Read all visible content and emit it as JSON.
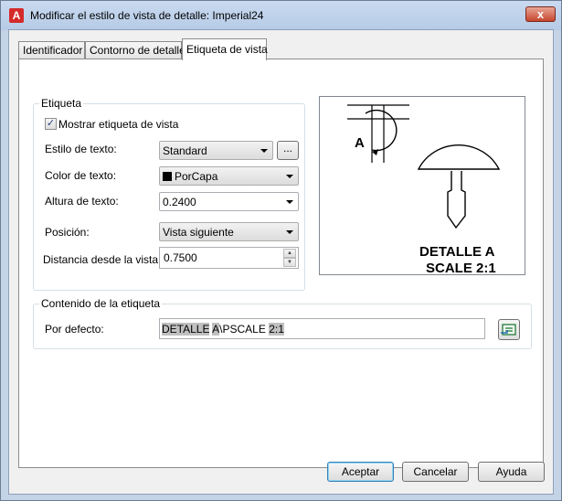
{
  "window": {
    "title": "Modificar el estilo de vista de detalle: Imperial24",
    "close_label": "x"
  },
  "tabs": [
    {
      "label": "Identificador"
    },
    {
      "label": "Contorno de detalle"
    },
    {
      "label": "Etiqueta de vista",
      "active": true
    }
  ],
  "etiqueta": {
    "group_title": "Etiqueta",
    "show_label": "Mostrar etiqueta de vista",
    "show_checked": true,
    "text_style_label": "Estilo de texto:",
    "text_style_value": "Standard",
    "browse_label": "...",
    "text_color_label": "Color de texto:",
    "text_color_value": "PorCapa",
    "text_color_swatch": "#000000",
    "text_height_label": "Altura de texto:",
    "text_height_value": "0.2400",
    "position_label": "Posición:",
    "position_value": "Vista siguiente",
    "distance_label": "Distancia desde la vista:",
    "distance_value": "0.7500"
  },
  "preview": {
    "marker_letter": "A",
    "detail_line1": "DETALLE A",
    "detail_line2": "SCALE 2:1"
  },
  "contenido": {
    "group_title": "Contenido de la etiqueta",
    "default_label": "Por defecto:",
    "default_part1": "DETALLE",
    "default_part2": " ",
    "default_part3": "A",
    "default_part4": "\\PSCALE ",
    "default_part5": "2:1"
  },
  "buttons": {
    "accept": "Aceptar",
    "cancel": "Cancelar",
    "help": "Ayuda"
  }
}
